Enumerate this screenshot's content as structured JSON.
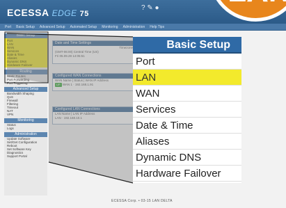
{
  "header": {
    "logo": "ECESSA",
    "logo_sub": "EDGE",
    "version": "75",
    "icons": "? ✎ ●"
  },
  "badge": {
    "text": "LAN"
  },
  "nav": [
    "Port",
    "Basic Setup",
    "Advanced Setup",
    "Automated Setup",
    "Monitoring",
    "Administration",
    "Help Tips"
  ],
  "sidebar": {
    "section1_title": "Basic Setup",
    "section1_items": [
      "Port",
      "LAN",
      "WAN",
      "Services",
      "Date & Time",
      "Aliases",
      "Dynamic DNS",
      "Hardware Failover"
    ],
    "section2_title": "Routing",
    "section2_items": [
      "Static Routes",
      "Port Forwarding",
      "Port Triggering"
    ],
    "section3_title": "Advanced Setup",
    "section3_items": [
      "Bandwidth Shaping",
      "QoS",
      "Firewall",
      "Filtering",
      "Timeout",
      "NAT",
      "VPN"
    ],
    "section4_title": "Monitoring",
    "section4_items": [
      "Status",
      "Logs"
    ],
    "section5_title": "Administration",
    "section5_items": [
      "Update Software",
      "Set/Get Configuration",
      "Reboot",
      "Set Software Key",
      "Diagnostics",
      "Support Portal"
    ]
  },
  "panels": {
    "time_title": "Date and Time Settings",
    "time_rows": [
      "Timezone",
      "(GMT-06:00) Central Time (US)",
      "Fri 05.09.28 14:05:51"
    ],
    "wan_title": "Configured WAN Connections",
    "wan_header": "WAN Name | Status | WAN IP Address",
    "wan_status": "UP",
    "wan_row": "WAN 1  ·  192.168.1.91",
    "lan_title": "Configured LAN Connections",
    "lan_header": "LAN Name | LAN IP Address",
    "lan_row": "LAN  ·  192.168.10.1"
  },
  "menu": {
    "title": "Basic Setup",
    "items": [
      "Port",
      "LAN",
      "WAN",
      "Services",
      "Date & Time",
      "Aliases",
      "Dynamic DNS",
      "Hardware Failover"
    ],
    "active": "LAN"
  },
  "footer": "ECESSA Corp. • 03-15 LAN DELTA"
}
